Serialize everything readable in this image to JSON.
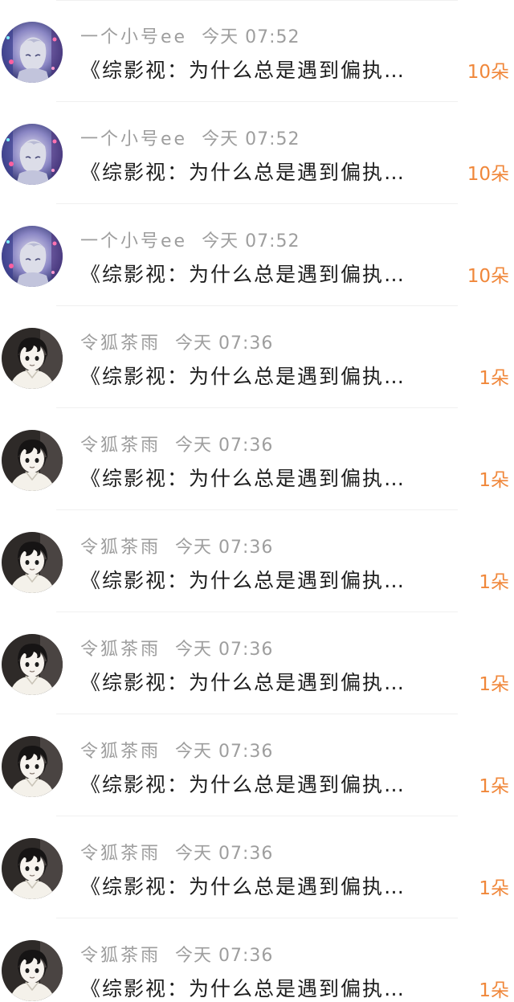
{
  "messages": [
    {
      "name": "一个小号ee",
      "time": "今天 07:52",
      "text": "《综影视：为什么总是遇到偏执…",
      "count": "10朵",
      "avatar": "avatar-a-icon"
    },
    {
      "name": "一个小号ee",
      "time": "今天 07:52",
      "text": "《综影视：为什么总是遇到偏执…",
      "count": "10朵",
      "avatar": "avatar-a-icon"
    },
    {
      "name": "一个小号ee",
      "time": "今天 07:52",
      "text": "《综影视：为什么总是遇到偏执…",
      "count": "10朵",
      "avatar": "avatar-a-icon"
    },
    {
      "name": "令狐茶雨",
      "time": "今天 07:36",
      "text": "《综影视：为什么总是遇到偏执…",
      "count": "1朵",
      "avatar": "avatar-b-icon"
    },
    {
      "name": "令狐茶雨",
      "time": "今天 07:36",
      "text": "《综影视：为什么总是遇到偏执…",
      "count": "1朵",
      "avatar": "avatar-b-icon"
    },
    {
      "name": "令狐茶雨",
      "time": "今天 07:36",
      "text": "《综影视：为什么总是遇到偏执…",
      "count": "1朵",
      "avatar": "avatar-b-icon"
    },
    {
      "name": "令狐茶雨",
      "time": "今天 07:36",
      "text": "《综影视：为什么总是遇到偏执…",
      "count": "1朵",
      "avatar": "avatar-b-icon"
    },
    {
      "name": "令狐茶雨",
      "time": "今天 07:36",
      "text": "《综影视：为什么总是遇到偏执…",
      "count": "1朵",
      "avatar": "avatar-b-icon"
    },
    {
      "name": "令狐茶雨",
      "time": "今天 07:36",
      "text": "《综影视：为什么总是遇到偏执…",
      "count": "1朵",
      "avatar": "avatar-b-icon"
    },
    {
      "name": "令狐茶雨",
      "time": "今天 07:36",
      "text": "《综影视：为什么总是遇到偏执…",
      "count": "1朵",
      "avatar": "avatar-b-icon"
    }
  ],
  "colors": {
    "name": "#9e9e9e",
    "message": "#1e1e1e",
    "count": "#f0873a",
    "divider": "#f0f0f0"
  }
}
